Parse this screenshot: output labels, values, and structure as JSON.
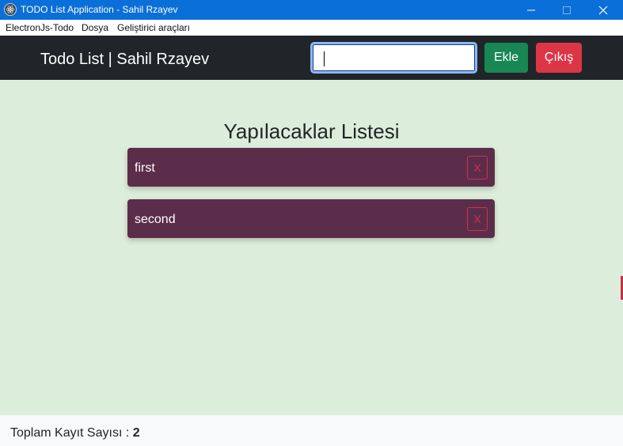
{
  "window": {
    "title": "TODO List Application - Sahil Rzayev",
    "icon": "electron-icon",
    "controls": [
      "minimize-icon",
      "maximize-icon",
      "close-icon"
    ]
  },
  "menu": {
    "items": [
      {
        "label": "ElectronJs-Todo"
      },
      {
        "label": "Dosya"
      },
      {
        "label": "Geliştirici araçları"
      }
    ]
  },
  "navbar": {
    "brand": "Todo List | Sahil Rzayev",
    "input": {
      "value": "",
      "placeholder": ""
    },
    "add_label": "Ekle",
    "exit_label": "Çıkış"
  },
  "main": {
    "heading": "Yapılacaklar Listesi",
    "todos": [
      {
        "text": "first",
        "delete_label": "X"
      },
      {
        "text": "second",
        "delete_label": "X"
      }
    ]
  },
  "footer": {
    "count_label": "Toplam Kayıt Sayısı :",
    "count_value": "2"
  },
  "colors": {
    "titlebar": "#0a6fd8",
    "navbar": "#212529",
    "add_button": "#198754",
    "exit_button": "#dc3545",
    "main_background": "#ddeddb",
    "todo_item": "#5c2d4a",
    "delete_accent": "#d0304a",
    "footer_background": "#f8f9fa"
  }
}
